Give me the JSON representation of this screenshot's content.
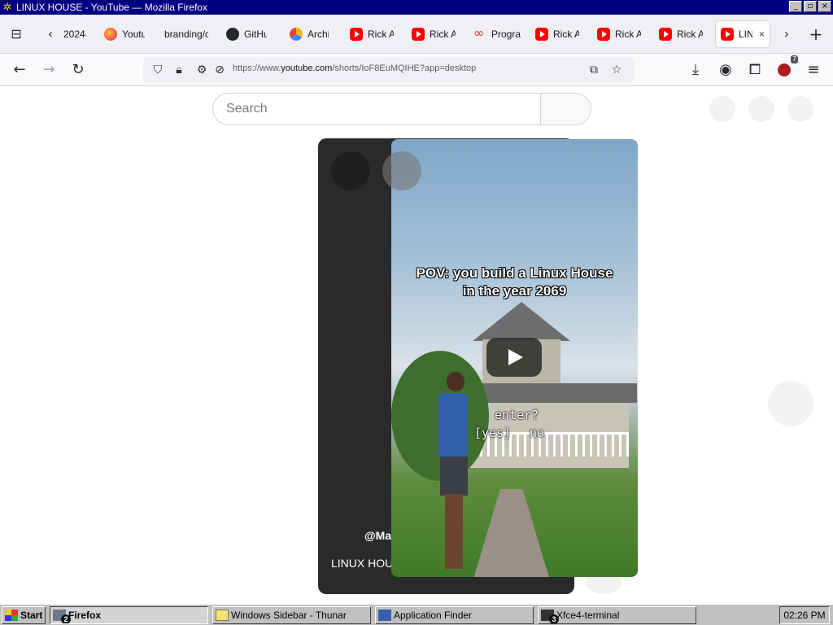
{
  "window": {
    "title": "LINUX HOUSE - YouTube — Mozilla Firefox",
    "minimize": "_",
    "maximize": "▫",
    "close": "×"
  },
  "tabs": [
    {
      "label": "2024-0",
      "favicon": "none"
    },
    {
      "label": "Youtu",
      "favicon": "firefox"
    },
    {
      "label": "branding/c",
      "favicon": "none"
    },
    {
      "label": "GitHu",
      "favicon": "github"
    },
    {
      "label": "Archiv",
      "favicon": "archive"
    },
    {
      "label": "Rick A",
      "favicon": "youtube"
    },
    {
      "label": "Rick A",
      "favicon": "youtube"
    },
    {
      "label": "Progra",
      "favicon": "prog"
    },
    {
      "label": "Rick A",
      "favicon": "youtube"
    },
    {
      "label": "Rick A",
      "favicon": "youtube"
    },
    {
      "label": "Rick A",
      "favicon": "youtube"
    },
    {
      "label": "LIN",
      "favicon": "youtube",
      "active": true
    }
  ],
  "tab_close": "×",
  "nav": {
    "url_prefix": "https://www.",
    "url_domain": "youtube.com",
    "url_path": "/shorts/IoF8EuMQIHE?app=desktop",
    "extension_badge": "7"
  },
  "search": {
    "placeholder": "Search"
  },
  "short": {
    "overlay_line1": "POV: you build a Linux House",
    "overlay_line2": "in the year 2069",
    "enter_text": "enter?",
    "yes_text": "[yes]",
    "no_text": "no",
    "channel": "@Ma",
    "title": "LINUX HOUS"
  },
  "taskbar": {
    "start": "Start",
    "firefox": "Firefox",
    "firefox_count": "2",
    "thunar": "Windows Sidebar - Thunar",
    "appfinder": "Application Finder",
    "terminal": "Xfce4-terminal",
    "terminal_count": "3",
    "clock": "02:26 PM"
  },
  "colors": {
    "titlebar": "#000080",
    "taskbar": "#c0c0c0",
    "youtube_red": "#ff0000",
    "card_bg": "#2a2a2a"
  }
}
